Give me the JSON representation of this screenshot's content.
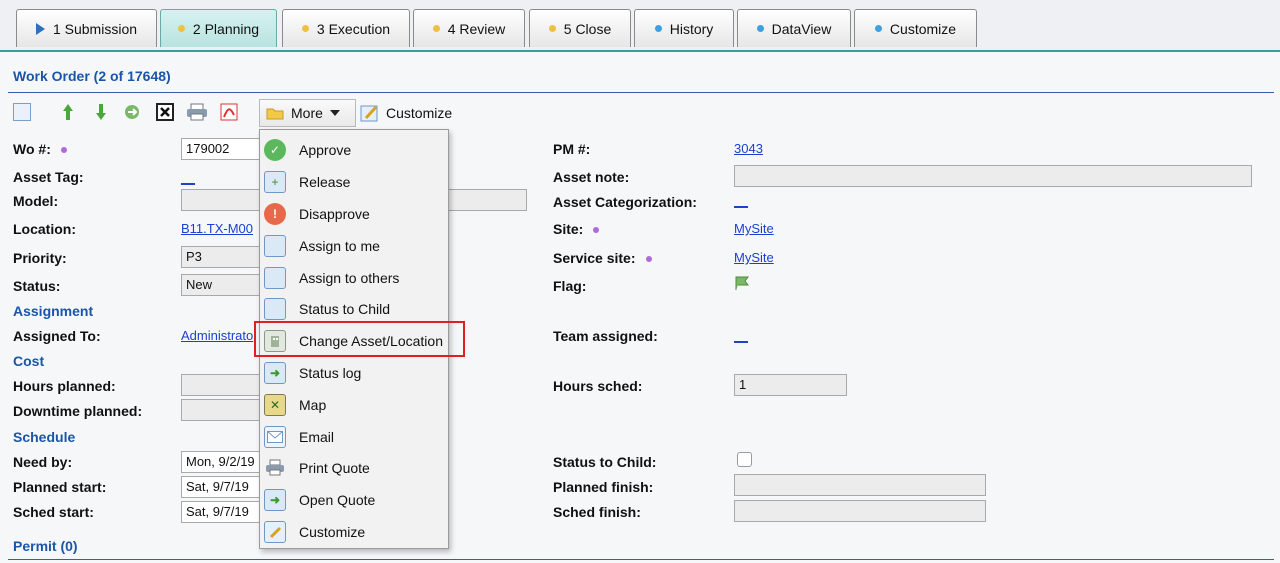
{
  "tabs": [
    {
      "label": "1 Submission",
      "icon": "play-triangle-icon",
      "dot": "#2f6fc1"
    },
    {
      "label": "2 Planning",
      "icon": "dot-icon",
      "dot": "#f0c040",
      "active": true
    },
    {
      "label": "3 Execution",
      "icon": "dot-icon",
      "dot": "#f0c040"
    },
    {
      "label": "4 Review",
      "icon": "dot-icon",
      "dot": "#f0c040"
    },
    {
      "label": "5 Close",
      "icon": "dot-icon",
      "dot": "#f0c040"
    },
    {
      "label": "History",
      "icon": "dot-icon",
      "dot": "#3fa0e0"
    },
    {
      "label": "DataView",
      "icon": "dot-icon",
      "dot": "#3fa0e0"
    },
    {
      "label": "Customize",
      "icon": "dot-icon",
      "dot": "#3fa0e0"
    }
  ],
  "section_title": "Work Order (2 of 17648)",
  "toolbar": {
    "more_label": "More",
    "customize_label": "Customize"
  },
  "left": {
    "wo_label": "Wo #:",
    "wo_value": "179002",
    "asset_tag_label": "Asset Tag:",
    "model_label": "Model:",
    "location_label": "Location:",
    "location_value": "B11.TX-M00",
    "priority_label": "Priority:",
    "priority_value": "P3",
    "status_label": "Status:",
    "status_value": "New",
    "assignment_group": "Assignment",
    "assigned_to_label": "Assigned To:",
    "assigned_to_value": "Administrato",
    "cost_group": "Cost",
    "hours_planned_label": "Hours planned:",
    "downtime_planned_label": "Downtime planned:",
    "schedule_group": "Schedule",
    "need_by_label": "Need by:",
    "need_by_value": "Mon, 9/2/19",
    "planned_start_label": "Planned start:",
    "planned_start_value": "Sat, 9/7/19",
    "sched_start_label": "Sched start:",
    "sched_start_value": "Sat, 9/7/19",
    "permit_group": "Permit (0)"
  },
  "right": {
    "pm_label": "PM #:",
    "pm_value": "3043",
    "asset_note_label": "Asset note:",
    "asset_cat_label": "Asset Categorization:",
    "site_label": "Site:",
    "site_value": "MySite",
    "service_site_label": "Service site:",
    "service_site_value": "MySite",
    "flag_label": "Flag:",
    "team_label": "Team assigned:",
    "hours_sched_label": "Hours sched:",
    "hours_sched_value": "1",
    "status_child_label": "Status to Child:",
    "planned_finish_label": "Planned finish:",
    "sched_finish_label": "Sched finish:"
  },
  "menu": [
    {
      "label": "Approve",
      "icon": "check-circle-icon"
    },
    {
      "label": "Release",
      "icon": "document-add-icon"
    },
    {
      "label": "Disapprove",
      "icon": "alert-circle-icon"
    },
    {
      "label": "Assign to me",
      "icon": "document-icon"
    },
    {
      "label": "Assign to others",
      "icon": "document-icon"
    },
    {
      "label": "Status to Child",
      "icon": "document-icon"
    },
    {
      "label": "Change Asset/Location",
      "icon": "building-icon"
    },
    {
      "label": "Status log",
      "icon": "arrow-right-icon"
    },
    {
      "label": "Map",
      "icon": "map-icon"
    },
    {
      "label": "Email",
      "icon": "envelope-icon"
    },
    {
      "label": "Print Quote",
      "icon": "printer-icon"
    },
    {
      "label": "Open Quote",
      "icon": "arrow-right-icon"
    },
    {
      "label": "Customize",
      "icon": "edit-icon"
    }
  ]
}
